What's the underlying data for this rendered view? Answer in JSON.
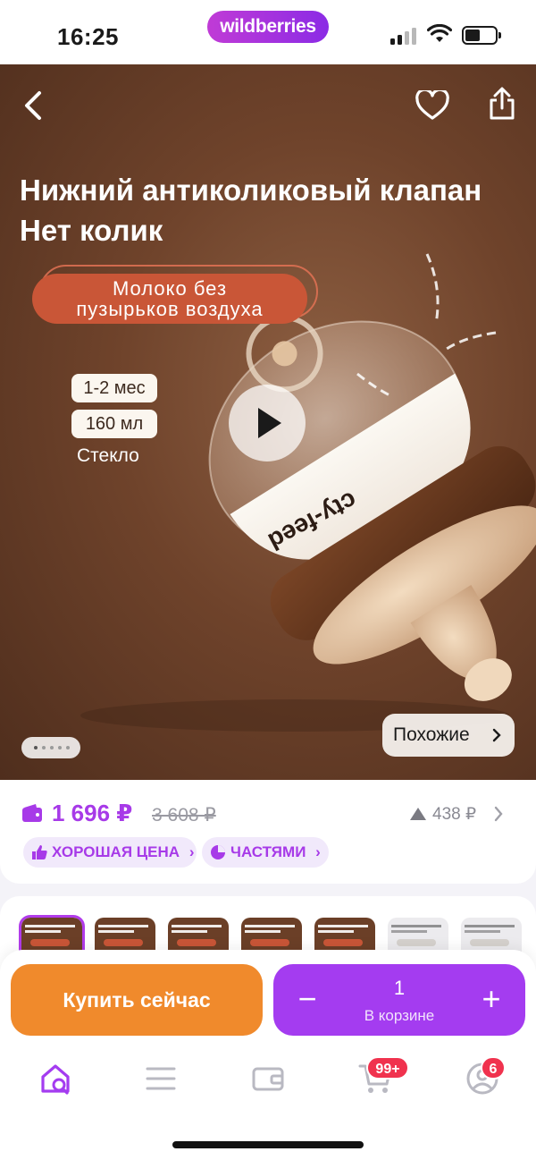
{
  "status_bar": {
    "time": "16:25",
    "brand": "wildberries"
  },
  "hero": {
    "title_line1": "Нижний антиколиковый клапан",
    "title_line2": "Нет колик",
    "promo_line1": "Молоко без",
    "promo_line2": "пузырьков воздуха",
    "spec_age": "1-2 мес",
    "spec_volume": "160 мл",
    "spec_material": "Стекло",
    "bottle_brand": "cty-feed",
    "similar_label": "Похожие",
    "gallery_dots": 5,
    "gallery_active_index": 0
  },
  "price": {
    "current": "1 696 ₽",
    "old": "3 608 ₽",
    "drop": "438 ₽",
    "badge_good_price": "ХОРОШАЯ ЦЕНА",
    "badge_installments": "ЧАСТЯМИ"
  },
  "thumbnails": [
    {
      "style": "dark",
      "selected": true
    },
    {
      "style": "dark",
      "selected": false
    },
    {
      "style": "dark",
      "selected": false
    },
    {
      "style": "dark",
      "selected": false
    },
    {
      "style": "dark",
      "selected": false
    },
    {
      "style": "light",
      "selected": false
    },
    {
      "style": "light",
      "selected": false
    }
  ],
  "actions": {
    "buy_now": "Купить сейчас",
    "quantity": "1",
    "in_cart_label": "В корзине",
    "minus": "−",
    "plus": "+"
  },
  "tab_bar": {
    "cart_badge": "99+",
    "profile_badge": "6"
  },
  "colors": {
    "accent": "#a43cf0",
    "buy": "#f08a2c",
    "promo": "#c95637",
    "badge_red": "#f0324e"
  },
  "icons": [
    "back-icon",
    "heart-icon",
    "share-icon",
    "play-icon",
    "chevron-right-icon",
    "wallet-icon",
    "price-drop-arrow-icon",
    "thumbs-up-icon",
    "pie-chart-icon",
    "home-search-icon",
    "menu-icon",
    "wallet-tab-icon",
    "cart-icon",
    "profile-icon"
  ]
}
